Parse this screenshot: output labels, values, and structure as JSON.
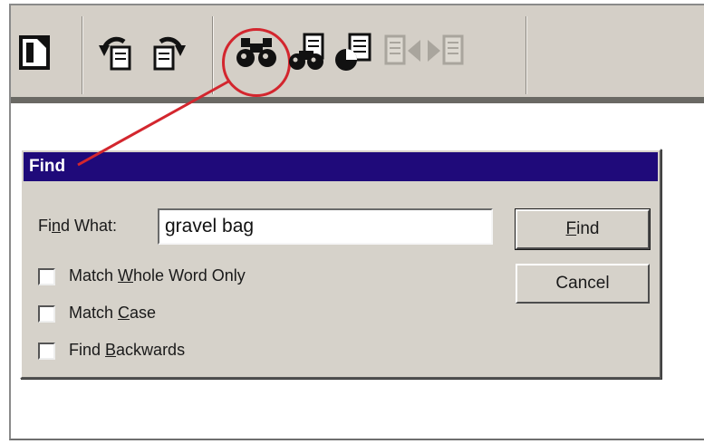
{
  "toolbar": {
    "buttons": [
      {
        "icon": "new-document-icon"
      },
      {
        "icon": "undo-icon"
      },
      {
        "icon": "redo-icon"
      },
      {
        "icon": "find-binoculars-icon",
        "highlighted": true
      },
      {
        "icon": "find-next-icon"
      },
      {
        "icon": "document-properties-icon"
      },
      {
        "icon": "previous-page-icon",
        "disabled": true
      },
      {
        "icon": "next-page-icon",
        "disabled": true
      }
    ]
  },
  "annotation": {
    "color": "#d3262e"
  },
  "dialog": {
    "title": "Find",
    "titlebar_color": "#1f0a7a",
    "find_what": {
      "pre": "Fi",
      "key": "n",
      "post": "d What:"
    },
    "find_input_value": "gravel bag",
    "options": [
      {
        "pre": "Match ",
        "key": "W",
        "post": "hole Word Only",
        "checked": false
      },
      {
        "pre": "Match ",
        "key": "C",
        "post": "ase",
        "checked": false
      },
      {
        "pre": "Find ",
        "key": "B",
        "post": "ackwards",
        "checked": false
      }
    ],
    "find_button": {
      "pre": "",
      "key": "F",
      "post": "ind"
    },
    "cancel_button": "Cancel"
  }
}
